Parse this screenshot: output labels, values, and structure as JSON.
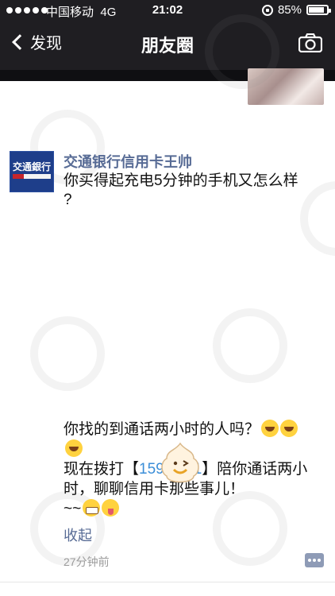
{
  "status_bar": {
    "carrier": "中国移动",
    "network": "4G",
    "time": "21:02",
    "battery_percent": "85%",
    "battery_level": 0.85
  },
  "nav": {
    "back_label": "发现",
    "title": "朋友圈",
    "camera_icon": "camera-icon"
  },
  "post": {
    "author": "交通银行信用卡王帅",
    "avatar_text": "交通銀行",
    "text_line1": "你买得起充电5分钟的手机又怎么样",
    "text_line2": "?",
    "body_part1": "你找的到通话两小时的人吗？",
    "body_call_prefix": "现在拨打【",
    "body_phone": "159 8491",
    "body_call_suffix": "】陪你通话两小时，聊聊信用卡那些事儿！",
    "body_tail": "~~",
    "collapse_label": "收起",
    "time_ago": "27分钟前"
  },
  "colors": {
    "nav_bg": "#1f1e22",
    "link": "#576b95",
    "phone": "#3b8ed8",
    "timestamp": "#9b9b9b"
  }
}
